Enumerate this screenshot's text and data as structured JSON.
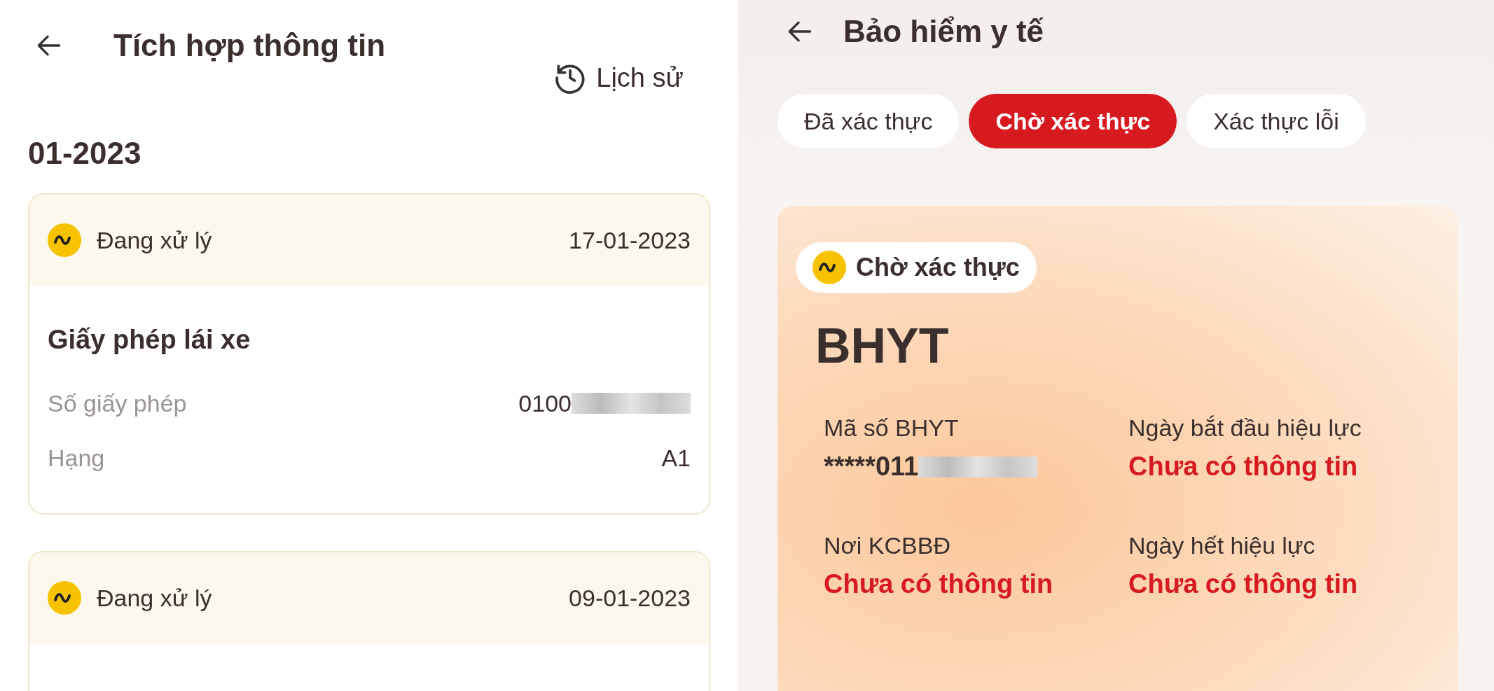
{
  "left": {
    "title": "Tích hợp thông tin",
    "history": "Lịch sử",
    "month": "01-2023",
    "cards": [
      {
        "status": "Đang xử lý",
        "date": "17-01-2023",
        "doc_title": "Giấy phép lái xe",
        "fields": [
          {
            "label": "Số giấy phép",
            "value": "0100",
            "redacted": true
          },
          {
            "label": "Hạng",
            "value": "A1",
            "redacted": false
          }
        ]
      },
      {
        "status": "Đang xử lý",
        "date": "09-01-2023"
      }
    ]
  },
  "right": {
    "title": "Bảo hiểm y tế",
    "tabs": [
      {
        "label": "Đã xác thực",
        "selected": false
      },
      {
        "label": "Chờ xác thực",
        "selected": true
      },
      {
        "label": "Xác thực lỗi",
        "selected": false
      }
    ],
    "card": {
      "badge": "Chờ xác thực",
      "title": "BHYT",
      "fields": [
        {
          "label": "Mã số BHYT",
          "value": "*****011",
          "redacted": true,
          "missing": false
        },
        {
          "label": "Ngày bắt đầu hiệu lực",
          "value": "Chưa có thông tin",
          "redacted": false,
          "missing": true
        },
        {
          "label": "Nơi KCBBĐ",
          "value": "Chưa có thông tin",
          "redacted": false,
          "missing": true
        },
        {
          "label": "Ngày hết hiệu lực",
          "value": "Chưa có thông tin",
          "redacted": false,
          "missing": true
        }
      ]
    }
  }
}
